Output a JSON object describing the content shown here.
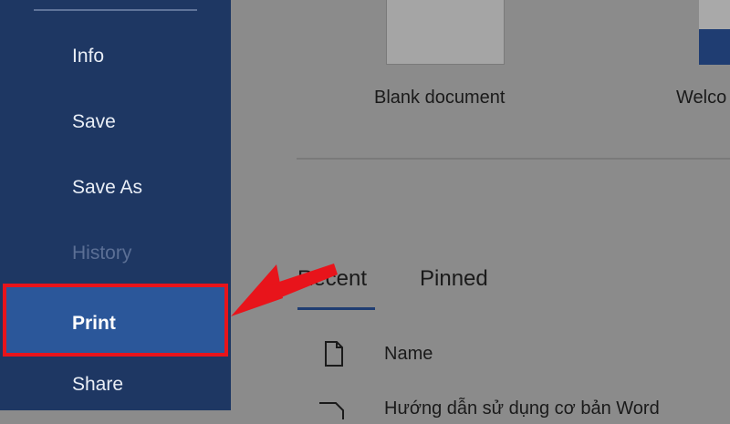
{
  "sidebar": {
    "items": [
      {
        "label": "Info"
      },
      {
        "label": "Save"
      },
      {
        "label": "Save As"
      },
      {
        "label": "History"
      },
      {
        "label": "Print"
      },
      {
        "label": "Share"
      }
    ]
  },
  "templates": {
    "blank_label": "Blank document",
    "welcome_label": "Welco"
  },
  "tabs": {
    "recent": "Recent",
    "pinned": "Pinned"
  },
  "file_list": {
    "column_name": "Name",
    "first_row": "Hướng dẫn sử dụng cơ bản Word"
  },
  "colors": {
    "sidebar_bg": "#1e3763",
    "selected_bg": "#2b579a",
    "highlight_red": "#e8141b",
    "overlay_gray": "#8b8b8b"
  }
}
